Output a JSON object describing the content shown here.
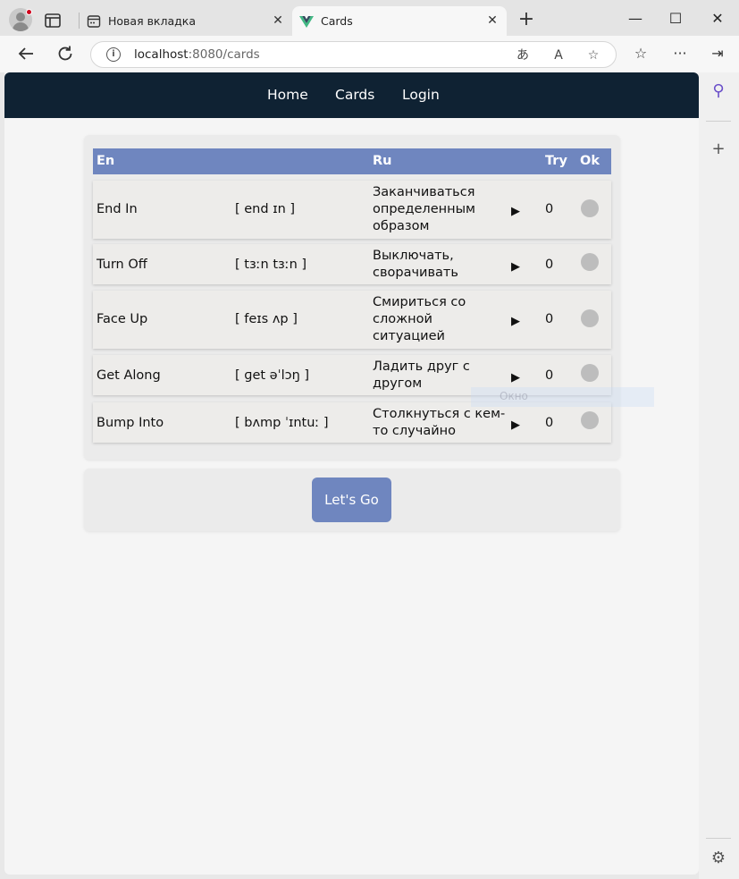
{
  "browser": {
    "tabs": [
      {
        "title": "Новая вкладка",
        "icon": "new-tab-icon"
      },
      {
        "title": "Cards",
        "icon": "vue-logo-icon"
      }
    ],
    "address": {
      "host": "localhost",
      "path": ":8080/cards"
    }
  },
  "nav": {
    "links": [
      "Home",
      "Cards",
      "Login"
    ]
  },
  "table": {
    "headers": {
      "en": "En",
      "ru": "Ru",
      "try": "Try",
      "ok": "Ok"
    },
    "rows": [
      {
        "en": "End In",
        "transcription": "[ end ɪn ]",
        "ru": "Заканчиваться определенным образом",
        "try": "0"
      },
      {
        "en": "Turn Off",
        "transcription": "[ tɜːn tɜːn ]",
        "ru": "Выключать, сворачивать",
        "try": "0"
      },
      {
        "en": "Face Up",
        "transcription": "[ feɪs ʌp ]",
        "ru": "Смириться со сложной ситуацией",
        "try": "0"
      },
      {
        "en": "Get Along",
        "transcription": "[ ɡet əˈlɔŋ ]",
        "ru": "Ладить друг с другом",
        "try": "0"
      },
      {
        "en": "Bump Into",
        "transcription": "[ bʌmp ˈɪntuː ]",
        "ru": "Столкнуться с кем-то случайно",
        "try": "0"
      }
    ]
  },
  "action": {
    "button_label": "Let's Go"
  },
  "ghost_label": "Окно",
  "colors": {
    "nav_bg": "#0f2233",
    "accent": "#6f86bf",
    "ok_circle": "#bdbdbd"
  }
}
